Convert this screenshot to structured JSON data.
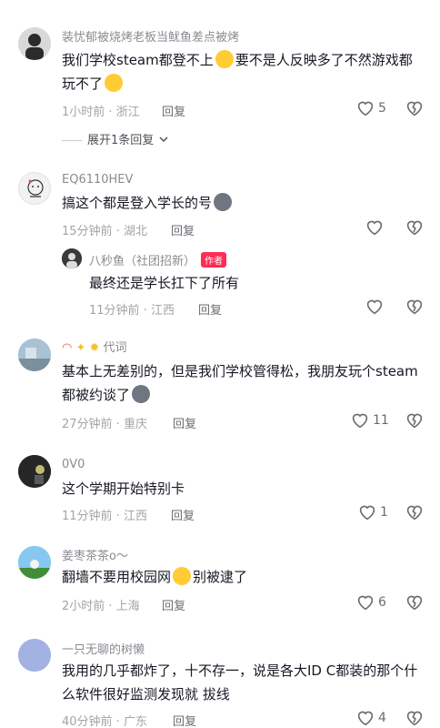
{
  "comments": [
    {
      "user": "装忧郁被烧烤老板当鱿鱼差点被烤",
      "text_a": "我们学校steam都登不上",
      "text_b": "要不是人反映多了不然游戏都玩不了",
      "time_loc": "1小时前 · 浙江",
      "reply": "回复",
      "likes": "5",
      "expand": "展开1条回复"
    },
    {
      "user": "EQ6110HEV",
      "text": "搞这个都是登入学长的号",
      "time_loc": "15分钟前 · 湖北",
      "reply": "回复",
      "likes": ""
    },
    {
      "user": "八秒鱼（社团招新）",
      "badge": "作者",
      "text": "最终还是学长扛下了所有",
      "time_loc": "11分钟前 · 江西",
      "reply": "回复",
      "likes": ""
    },
    {
      "user": "代词",
      "text": "基本上无差别的，但是我们学校管得松，我朋友玩个steam都被约谈了",
      "time_loc": "27分钟前 · 重庆",
      "reply": "回复",
      "likes": "11"
    },
    {
      "user": "0V0",
      "text": "这个学期开始特别卡",
      "time_loc": "11分钟前 · 江西",
      "reply": "回复",
      "likes": "1"
    },
    {
      "user": "姜枣茶茶o～",
      "text_a": "翻墙不要用校园网",
      "text_b": "别被逮了",
      "time_loc": "2小时前 · 上海",
      "reply": "回复",
      "likes": "6"
    },
    {
      "user": "一只无聊的树懒",
      "text": "我用的几乎都炸了，十不存一，说是各大ID C都装的那个什么软件很好监测发现就 拔线",
      "time_loc": "40分钟前 · 广东",
      "reply": "回复",
      "likes": "4"
    }
  ]
}
